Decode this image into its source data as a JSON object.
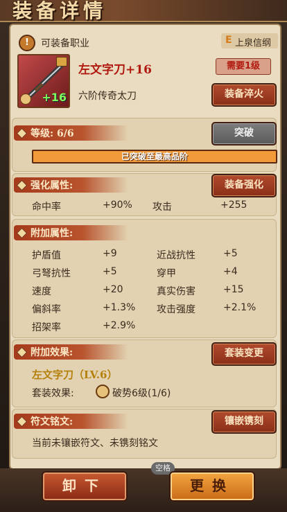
{
  "header": {
    "title": "装备详情"
  },
  "profession": {
    "label": "可装备职业",
    "badge_letter": "E",
    "tag": "上泉信纲"
  },
  "item": {
    "name": "左文字刀+16",
    "level_badge": "+16",
    "requirement": "需要1级",
    "desc": "六阶传奇太刀",
    "temper_btn": "装备淬火"
  },
  "level": {
    "label": "等级: 6/6",
    "breakthrough_btn": "突破",
    "progress_text": "已突破至最高品阶",
    "progress_fraction": 1.0
  },
  "enhance": {
    "label": "强化属性:",
    "btn": "装备强化",
    "stats": [
      {
        "name": "命中率",
        "value": "+90%"
      },
      {
        "name": "攻击",
        "value": "+255"
      }
    ]
  },
  "extra": {
    "label": "附加属性:",
    "stats": [
      {
        "name": "护盾值",
        "value": "+9"
      },
      {
        "name": "近战抗性",
        "value": "+5"
      },
      {
        "name": "弓弩抗性",
        "value": "+5"
      },
      {
        "name": "穿甲",
        "value": "+4"
      },
      {
        "name": "速度",
        "value": "+20"
      },
      {
        "name": "真实伤害",
        "value": "+15"
      },
      {
        "name": "偏斜率",
        "value": "+1.3%"
      },
      {
        "name": "攻击强度",
        "value": "+2.1%"
      },
      {
        "name": "招架率",
        "value": "+2.9%"
      }
    ]
  },
  "set": {
    "label": "附加效果:",
    "btn": "套装变更",
    "set_name": "左文字刀（LV.6）",
    "effect_label": "套装效果:",
    "effect_value": "破势6级(1/6)"
  },
  "rune": {
    "label": "符文铭文:",
    "btn": "镶嵌镌刻",
    "desc": "当前未镶嵌符文、未镌刻铭文"
  },
  "footer": {
    "unequip": "卸下",
    "replace": "更换",
    "hint": "空格"
  },
  "colors": {
    "accent_red": "#a63a1c",
    "gold": "#f0b54a",
    "green": "#7dff5e"
  }
}
